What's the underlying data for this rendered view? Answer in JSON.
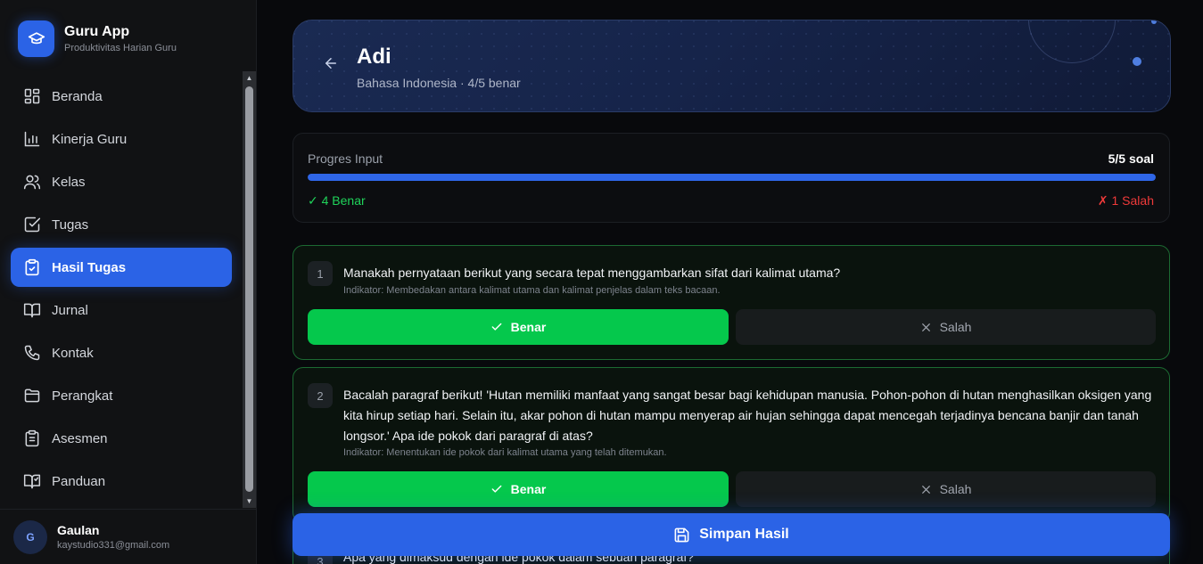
{
  "brand": {
    "title": "Guru App",
    "subtitle": "Produktivitas Harian Guru",
    "accent": "#2b63e6"
  },
  "nav": [
    {
      "label": "Beranda",
      "icon": "dashboard-icon",
      "active": false
    },
    {
      "label": "Kinerja Guru",
      "icon": "bar-chart-icon",
      "active": false
    },
    {
      "label": "Kelas",
      "icon": "users-icon",
      "active": false
    },
    {
      "label": "Tugas",
      "icon": "checkbox-icon",
      "active": false
    },
    {
      "label": "Hasil Tugas",
      "icon": "clipboard-check-icon",
      "active": true
    },
    {
      "label": "Jurnal",
      "icon": "book-open-icon",
      "active": false
    },
    {
      "label": "Kontak",
      "icon": "phone-icon",
      "active": false
    },
    {
      "label": "Perangkat",
      "icon": "folder-icon",
      "active": false
    },
    {
      "label": "Asesmen",
      "icon": "clipboard-list-icon",
      "active": false
    },
    {
      "label": "Panduan",
      "icon": "book-guide-icon",
      "active": false
    }
  ],
  "user": {
    "initial": "G",
    "name": "Gaulan",
    "email": "kaystudio331@gmail.com"
  },
  "header": {
    "name": "Adi",
    "subtitle": "Bahasa Indonesia · 4/5 benar"
  },
  "progress": {
    "label": "Progres Input",
    "count": "5/5 soal",
    "fraction": 1.0,
    "correct": "✓ 4 Benar",
    "wrong": "✗ 1 Salah",
    "correct_color": "#1fd35a",
    "wrong_color": "#f03a3a"
  },
  "questions": [
    {
      "number": "1",
      "text": "Manakah pernyataan berikut yang secara tepat menggambarkan sifat dari kalimat utama?",
      "indicator": "Indikator: Membedakan antara kalimat utama dan kalimat penjelas dalam teks bacaan.",
      "benar_label": "Benar",
      "salah_label": "Salah",
      "answer": "benar"
    },
    {
      "number": "2",
      "text": "Bacalah paragraf berikut! 'Hutan memiliki manfaat yang sangat besar bagi kehidupan manusia. Pohon-pohon di hutan menghasilkan oksigen yang kita hirup setiap hari. Selain itu, akar pohon di hutan mampu menyerap air hujan sehingga dapat mencegah terjadinya bencana banjir dan tanah longsor.' Apa ide pokok dari paragraf di atas?",
      "indicator": "Indikator: Menentukan ide pokok dari kalimat utama yang telah ditemukan.",
      "benar_label": "Benar",
      "salah_label": "Salah",
      "answer": "benar"
    },
    {
      "number": "3",
      "text": "Apa yang dimaksud dengan ide pokok dalam sebuah paragraf?"
    }
  ],
  "save_label": "Simpan Hasil"
}
